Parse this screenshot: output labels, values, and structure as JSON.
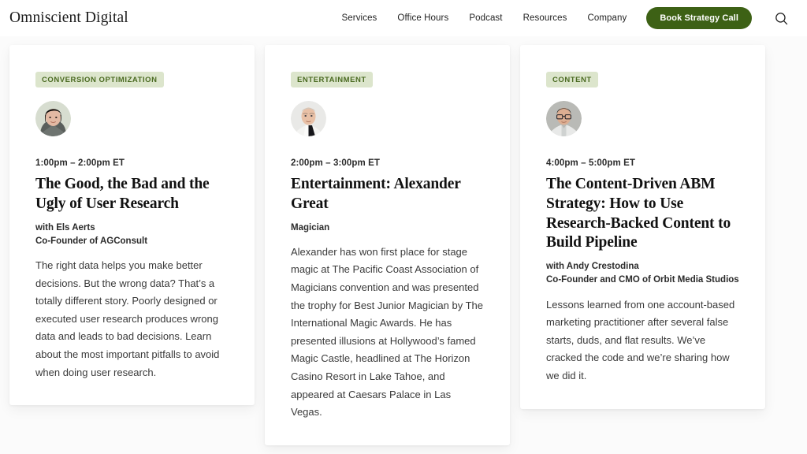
{
  "header": {
    "logo": "Omniscient Digital",
    "nav_links": [
      {
        "label": "Services"
      },
      {
        "label": "Office Hours"
      },
      {
        "label": "Podcast"
      },
      {
        "label": "Resources"
      },
      {
        "label": "Company"
      }
    ],
    "cta_label": "Book Strategy Call",
    "cta_color": "#3d6115",
    "search_icon": "search-icon"
  },
  "colors": {
    "page_background": "#fbfbfb",
    "card_background": "#ffffff",
    "badge_background": "#dce5cc",
    "badge_text": "#4b6b22",
    "accent_green": "#3d6115"
  },
  "sessions": [
    {
      "badge": "CONVERSION OPTIMIZATION",
      "avatar_name": "avatar-els-aerts",
      "time": "1:00pm – 2:00pm ET",
      "title": "The Good, the Bad and the Ugly of User Research",
      "speaker_name": "with Els Aerts",
      "speaker_role": "Co-Founder of AGConsult",
      "description": "The right data helps you make better decisions. But the wrong data? That’s a totally different story. Poorly designed or executed user research produces wrong data and leads to bad decisions. Learn about the most important pitfalls to avoid when doing user research."
    },
    {
      "badge": "ENTERTAINMENT",
      "avatar_name": "avatar-alexander-great",
      "time": "2:00pm – 3:00pm ET",
      "title": "Entertainment: Alexander Great",
      "speaker_name": "Magician",
      "speaker_role": "",
      "description": "Alexander has won first place for stage magic at The Pacific Coast Association of Magicians convention and was presented the trophy for Best Junior Magician by The International Magic Awards. He has presented illusions at Hollywood’s famed Magic Castle, headlined at The Horizon Casino Resort in Lake Tahoe, and appeared at Caesars Palace in Las Vegas."
    },
    {
      "badge": "CONTENT",
      "avatar_name": "avatar-andy-crestodina",
      "time": "4:00pm – 5:00pm ET",
      "title": "The Content-Driven ABM Strategy: How to Use Research-Backed Content to Build Pipeline",
      "speaker_name": "with Andy Crestodina",
      "speaker_role": "Co-Founder and CMO of Orbit Media Studios",
      "description": "Lessons learned from one account-based marketing practitioner after several false starts, duds, and flat results. We’ve cracked the code and we’re sharing how we did it."
    }
  ]
}
